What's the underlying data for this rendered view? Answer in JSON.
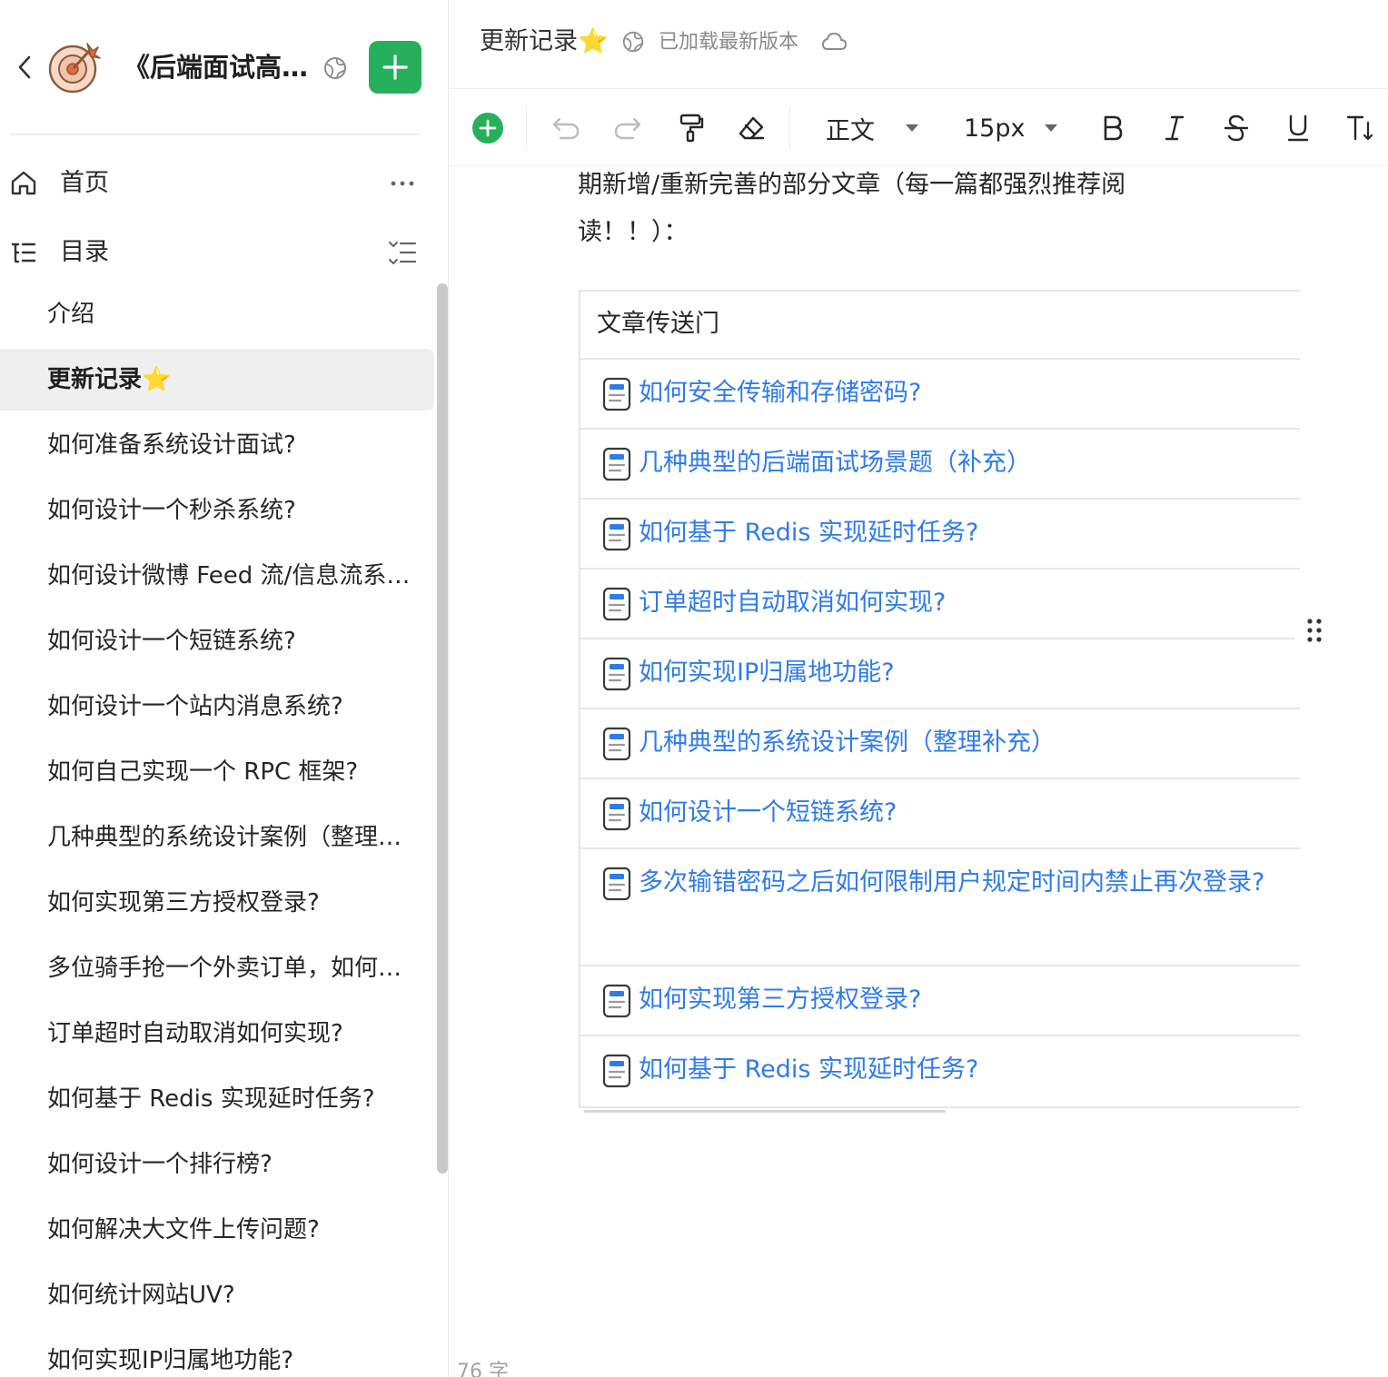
{
  "sidebar": {
    "book_title": "《后端面试高频系统设计&场景题》",
    "nav": {
      "home_label": "首页",
      "toc_label": "目录"
    },
    "toc_items": [
      {
        "label": "介绍"
      },
      {
        "label": "更新记录",
        "star": "⭐"
      },
      {
        "label": "如何准备系统设计面试?"
      },
      {
        "label": "如何设计一个秒杀系统?"
      },
      {
        "label": "如何设计微博 Feed 流/信息流系统?"
      },
      {
        "label": "如何设计一个短链系统?"
      },
      {
        "label": "如何设计一个站内消息系统?"
      },
      {
        "label": "如何自己实现一个 RPC 框架?"
      },
      {
        "label": "几种典型的系统设计案例（整理补充）"
      },
      {
        "label": "如何实现第三方授权登录?"
      },
      {
        "label": "多位骑手抢一个外卖订单，如何保证只有一个骑手可以接到单子?"
      },
      {
        "label": "订单超时自动取消如何实现?"
      },
      {
        "label": "如何基于 Redis 实现延时任务?"
      },
      {
        "label": "如何设计一个排行榜?"
      },
      {
        "label": "如何解决大文件上传问题?"
      },
      {
        "label": "如何统计网站UV?"
      },
      {
        "label": "如何实现IP归属地功能?"
      }
    ]
  },
  "topbar": {
    "doc_title": "更新记录",
    "doc_title_star": "⭐",
    "save_status": "已加载最新版本"
  },
  "toolbar": {
    "style_label": "正文",
    "font_size": "15px"
  },
  "content": {
    "paragraph": "期新增/重新完善的部分文章（每一篇都强烈推荐阅读！！）：",
    "table": {
      "header": "文章传送门",
      "rows": [
        {
          "title": "如何安全传输和存储密码?"
        },
        {
          "title": "几种典型的后端面试场景题（补充）"
        },
        {
          "title": "如何基于 Redis 实现延时任务?"
        },
        {
          "title": "订单超时自动取消如何实现?"
        },
        {
          "title": "如何实现IP归属地功能?"
        },
        {
          "title": "几种典型的系统设计案例（整理补充）"
        },
        {
          "title": "如何设计一个短链系统?"
        },
        {
          "title": "多次输错密码之后如何限制用户规定时间内禁止再次登录?"
        },
        {
          "title": "如何实现第三方授权登录?"
        },
        {
          "title": "如何基于 Redis 实现延时任务?"
        }
      ]
    },
    "word_count": "76 字"
  },
  "colors": {
    "accent_green": "#27b05c",
    "link_blue": "#2f7bea",
    "star_yellow": "#f5b301"
  }
}
